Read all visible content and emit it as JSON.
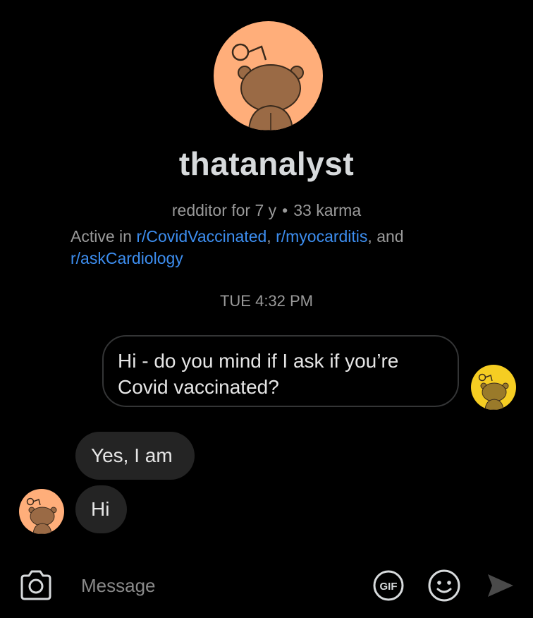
{
  "profile": {
    "username": "thatanalyst",
    "account_age": "redditor for 7 y",
    "karma": "33 karma",
    "active_prefix": "Active in ",
    "communities": [
      "r/CovidVaccinated",
      "r/myocarditis",
      "r/askCardiology"
    ],
    "separator": ", ",
    "and_text": ", and",
    "link_color": "#3d8ef0",
    "avatar_color": "#ffae7a"
  },
  "chat": {
    "timestamp": "TUE 4:32 PM",
    "messages": [
      {
        "sender": "me",
        "text": "Hi - do you mind if I ask if you’re Covid vaccinated?"
      },
      {
        "sender": "them",
        "text": "Yes, I am"
      },
      {
        "sender": "them",
        "text": "Hi"
      }
    ],
    "my_avatar_color": "#f5cd22"
  },
  "composer": {
    "placeholder": "Message",
    "gif_label": "GIF",
    "icons": [
      "camera-icon",
      "gif-icon",
      "emoji-icon",
      "send-icon"
    ]
  }
}
